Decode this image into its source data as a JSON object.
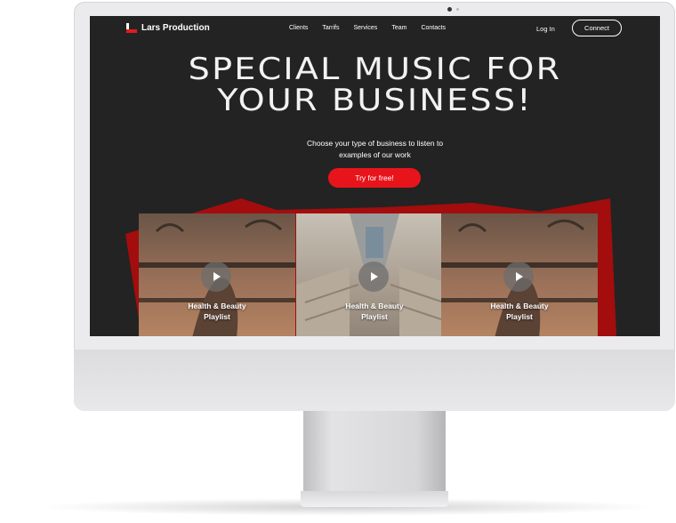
{
  "brand": {
    "name": "Lars Production"
  },
  "nav": {
    "items": [
      "Clients",
      "Tarrifs",
      "Services",
      "Team",
      "Contacts"
    ],
    "login": "Log In",
    "connect": "Connect"
  },
  "hero": {
    "title_line1": "SPECIAL MUSIC FOR",
    "title_line2": "YOUR BUSINESS!",
    "subtitle_line1": "Choose your type of business to listen to",
    "subtitle_line2": "examples of our work",
    "cta": "Try for free!"
  },
  "cards": [
    {
      "label_line1": "Health & Beauty",
      "label_line2": "Playlist",
      "icon": "play-icon"
    },
    {
      "label_line1": "Health & Beauty",
      "label_line2": "Playlist",
      "icon": "play-icon"
    },
    {
      "label_line1": "Health & Beauty",
      "label_line2": "Playlist",
      "icon": "play-icon"
    }
  ],
  "colors": {
    "accent": "#e8141b",
    "background": "#232323",
    "text": "#ffffff"
  }
}
